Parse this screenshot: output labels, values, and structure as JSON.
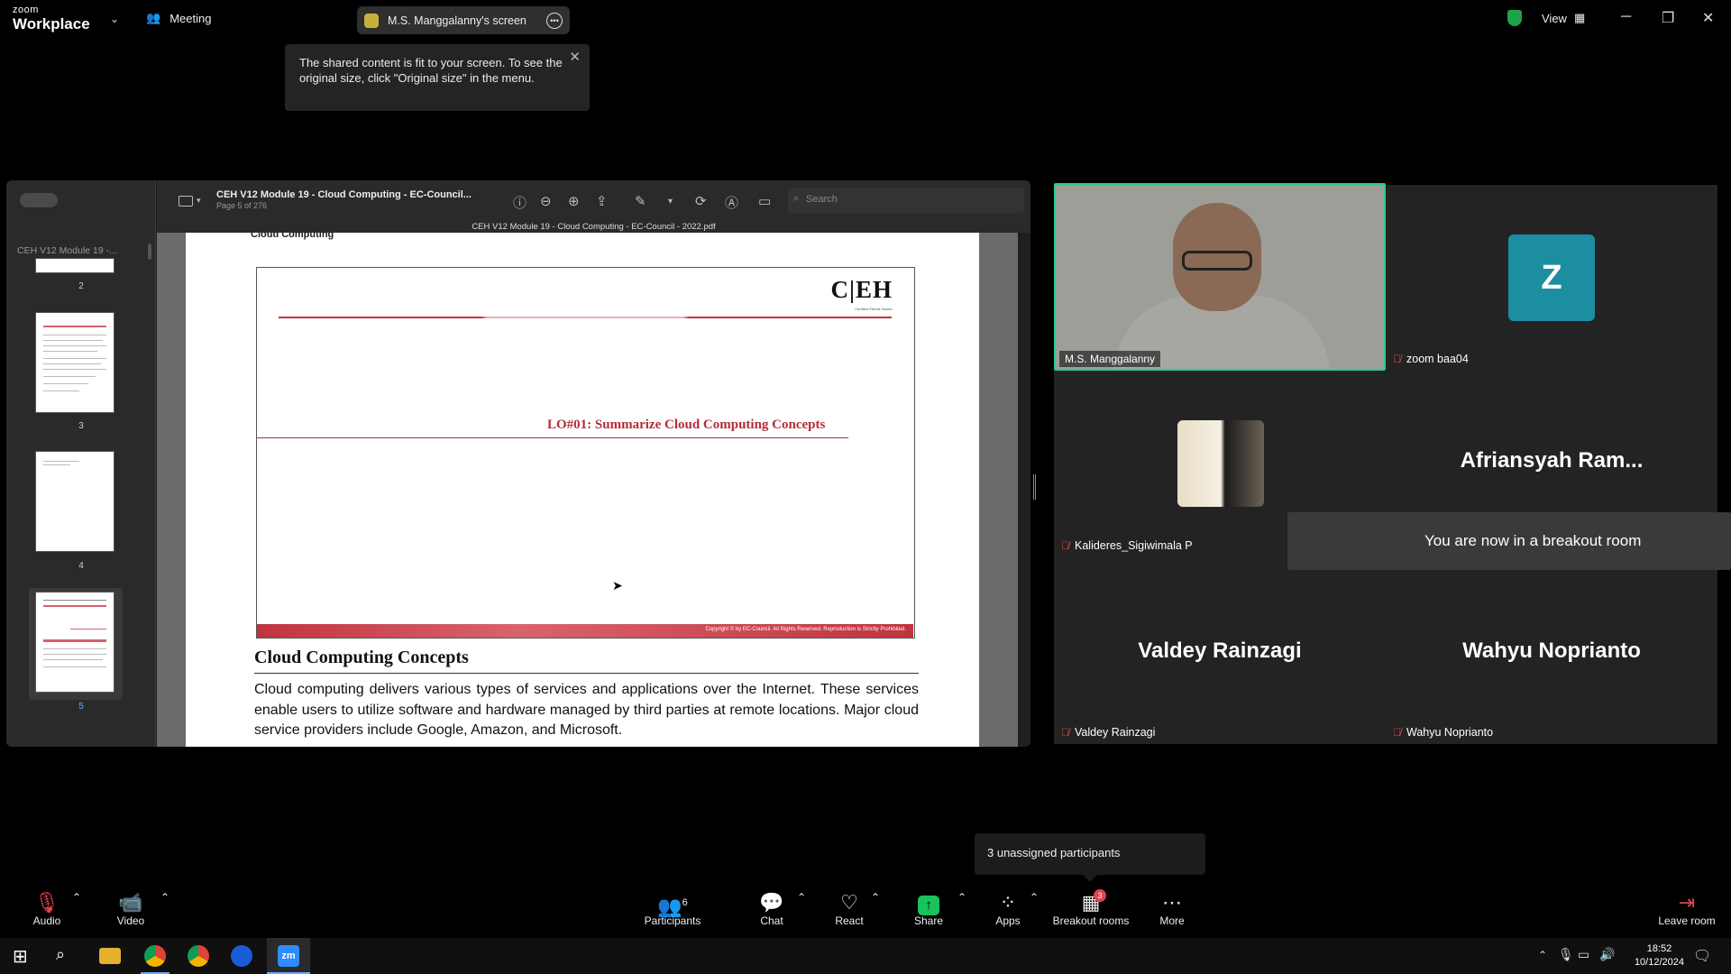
{
  "app": {
    "logo_top": "zoom",
    "logo_bottom": "Workplace",
    "meeting_label": "Meeting",
    "share_pill_label": "M.S. Manggalanny's screen",
    "view_label": "View"
  },
  "tooltip": {
    "text": "The shared content is fit to your screen. To see the original size, click \"Original size\" in the menu."
  },
  "pdf": {
    "sidebar_title": "CEH V12 Module 19 -...",
    "doc_title": "CEH V12 Module 19 - Cloud Computing - EC-Council...",
    "page_info": "Page 5 of 276",
    "window_title": "CEH V12 Module 19 - Cloud Computing - EC-Council - 2022.pdf",
    "search_placeholder": "Search",
    "thumbnails": [
      "2",
      "3",
      "4",
      "5"
    ],
    "running_header": "Cloud Computing",
    "slide_logo": "C|EH",
    "slide_logo_sub": "Certified Ethical Hacker",
    "slide_lo": "LO#01: Summarize Cloud Computing Concepts",
    "slide_footer": "Copyright © by EC-Council. All Rights Reserved. Reproduction is Strictly Prohibited.",
    "section_heading": "Cloud Computing Concepts",
    "body_text": "Cloud computing delivers various types of services and applications over the Internet. These services enable users to utilize software and hardware managed by third parties at remote locations. Major cloud service providers include Google, Amazon, and Microsoft."
  },
  "participants_grid": [
    {
      "name": "M.S. Manggalanny",
      "kind": "video"
    },
    {
      "name": "zoom baa04",
      "kind": "avatar",
      "initial": "Z"
    },
    {
      "name": "Kalideres_Sigiwimala P",
      "kind": "photo"
    },
    {
      "name": "Afriansyah Ram...",
      "kind": "text"
    },
    {
      "name": "Valdey Rainzagi",
      "kind": "text",
      "big": "Valdey Rainzagi"
    },
    {
      "name": "Wahyu Noprianto",
      "kind": "text",
      "big": "Wahyu Noprianto"
    }
  ],
  "toast": "You are now in a breakout room",
  "unassigned": "3 unassigned participants",
  "controls": {
    "audio": "Audio",
    "video": "Video",
    "participants": "Participants",
    "participants_count": "6",
    "chat": "Chat",
    "react": "React",
    "share": "Share",
    "apps": "Apps",
    "breakout": "Breakout rooms",
    "breakout_badge": "3",
    "more": "More",
    "leave": "Leave room"
  },
  "taskbar": {
    "time": "18:52",
    "date": "10/12/2024"
  },
  "colors": {
    "active_speaker": "#23d18b",
    "share_green": "#19c25c",
    "ceh_red": "#b32c37",
    "avatar_teal": "#1c8ea1"
  }
}
